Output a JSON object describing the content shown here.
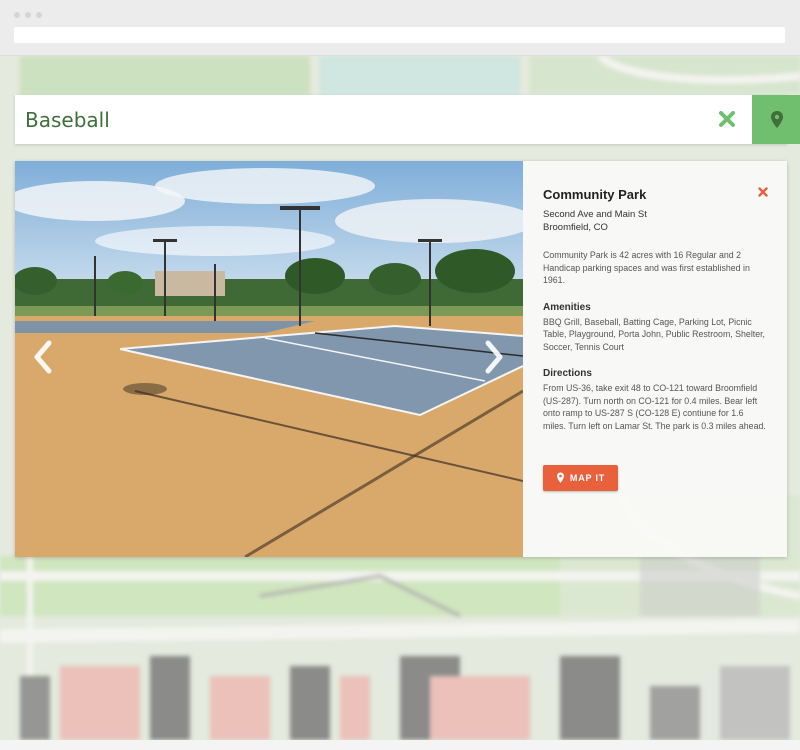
{
  "search": {
    "value": "Baseball",
    "clear_icon": "close-icon",
    "locate_icon": "map-pin-icon"
  },
  "park": {
    "name": "Community Park",
    "address_line1": "Second Ave and Main St",
    "address_line2": "Broomfield, CO",
    "description": "Community Park is 42 acres with 16 Regular and 2 Handicap parking spaces and was first established in 1961.",
    "amenities_title": "Amenities",
    "amenities": "BBQ Grill, Baseball, Batting Cage, Parking Lot, Picnic Table, Playground, Porta John, Public Restroom, Shelter, Soccer, Tennis Court",
    "directions_title": "Directions",
    "directions": "From US-36, take exit 48 to CO-121 toward Broomfield (US-287). Turn north on CO-121 for 0.4 miles. Bear left onto ramp to US-287 S (CO-128 E) contiune for 1.6 miles. Turn left on Lamar St. The park is 0.3 miles ahead.",
    "map_it_label": "MAP IT"
  },
  "colors": {
    "accent_green": "#6fbf6f",
    "map_it_orange": "#e8603c",
    "close_red": "#e8603c"
  }
}
